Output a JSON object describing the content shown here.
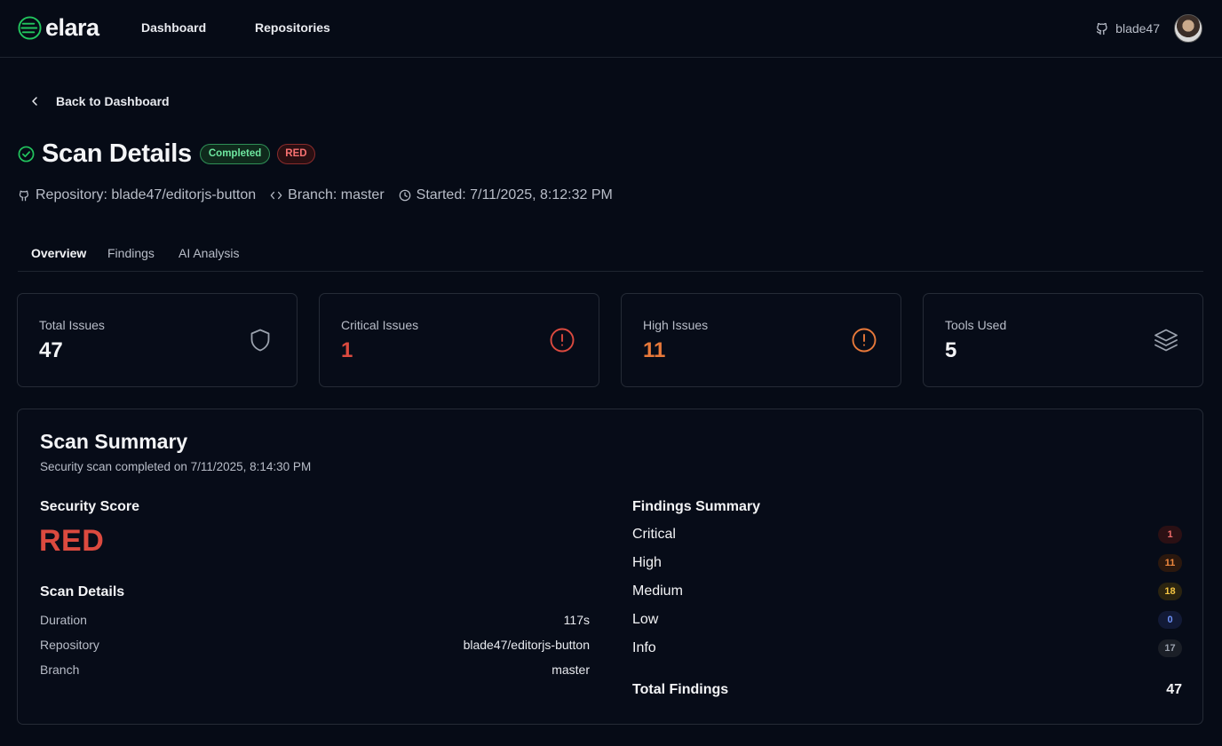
{
  "nav": {
    "brand": "elara",
    "links": [
      {
        "label": "Dashboard"
      },
      {
        "label": "Repositories"
      }
    ],
    "username": "blade47"
  },
  "back": {
    "label": "Back to Dashboard"
  },
  "header": {
    "title": "Scan Details",
    "status_badge": "Completed",
    "score_badge": "RED",
    "repository": "Repository: blade47/editorjs-button",
    "branch": "Branch: master",
    "started": "Started: 7/11/2025, 8:12:32 PM"
  },
  "tabs": [
    {
      "label": "Overview"
    },
    {
      "label": "Findings"
    },
    {
      "label": "AI Analysis"
    }
  ],
  "stats": [
    {
      "label": "Total Issues",
      "value": "47",
      "color": "#f3f4f6",
      "icon": "shield-icon"
    },
    {
      "label": "Critical Issues",
      "value": "1",
      "color": "#dc4a3f",
      "icon": "alert-circle-icon"
    },
    {
      "label": "High Issues",
      "value": "11",
      "color": "#e8793a",
      "icon": "alert-circle-icon"
    },
    {
      "label": "Tools Used",
      "value": "5",
      "color": "#f3f4f6",
      "icon": "layers-icon"
    }
  ],
  "summary": {
    "title": "Scan Summary",
    "subtitle": "Security scan completed on 7/11/2025, 8:14:30 PM",
    "security_score_label": "Security Score",
    "security_score": "RED",
    "scan_details_label": "Scan Details",
    "details": [
      {
        "key": "Duration",
        "value": "117s"
      },
      {
        "key": "Repository",
        "value": "blade47/editorjs-button"
      },
      {
        "key": "Branch",
        "value": "master"
      }
    ],
    "findings_label": "Findings Summary",
    "findings": [
      {
        "key": "Critical",
        "value": "1"
      },
      {
        "key": "High",
        "value": "11"
      },
      {
        "key": "Medium",
        "value": "18"
      },
      {
        "key": "Low",
        "value": "0"
      },
      {
        "key": "Info",
        "value": "17"
      }
    ],
    "total_label": "Total Findings",
    "total_value": "47"
  },
  "colors": {
    "background": "#060b16",
    "accent_green": "#22c55e",
    "critical": "#dc4a3f",
    "high": "#e8793a"
  }
}
